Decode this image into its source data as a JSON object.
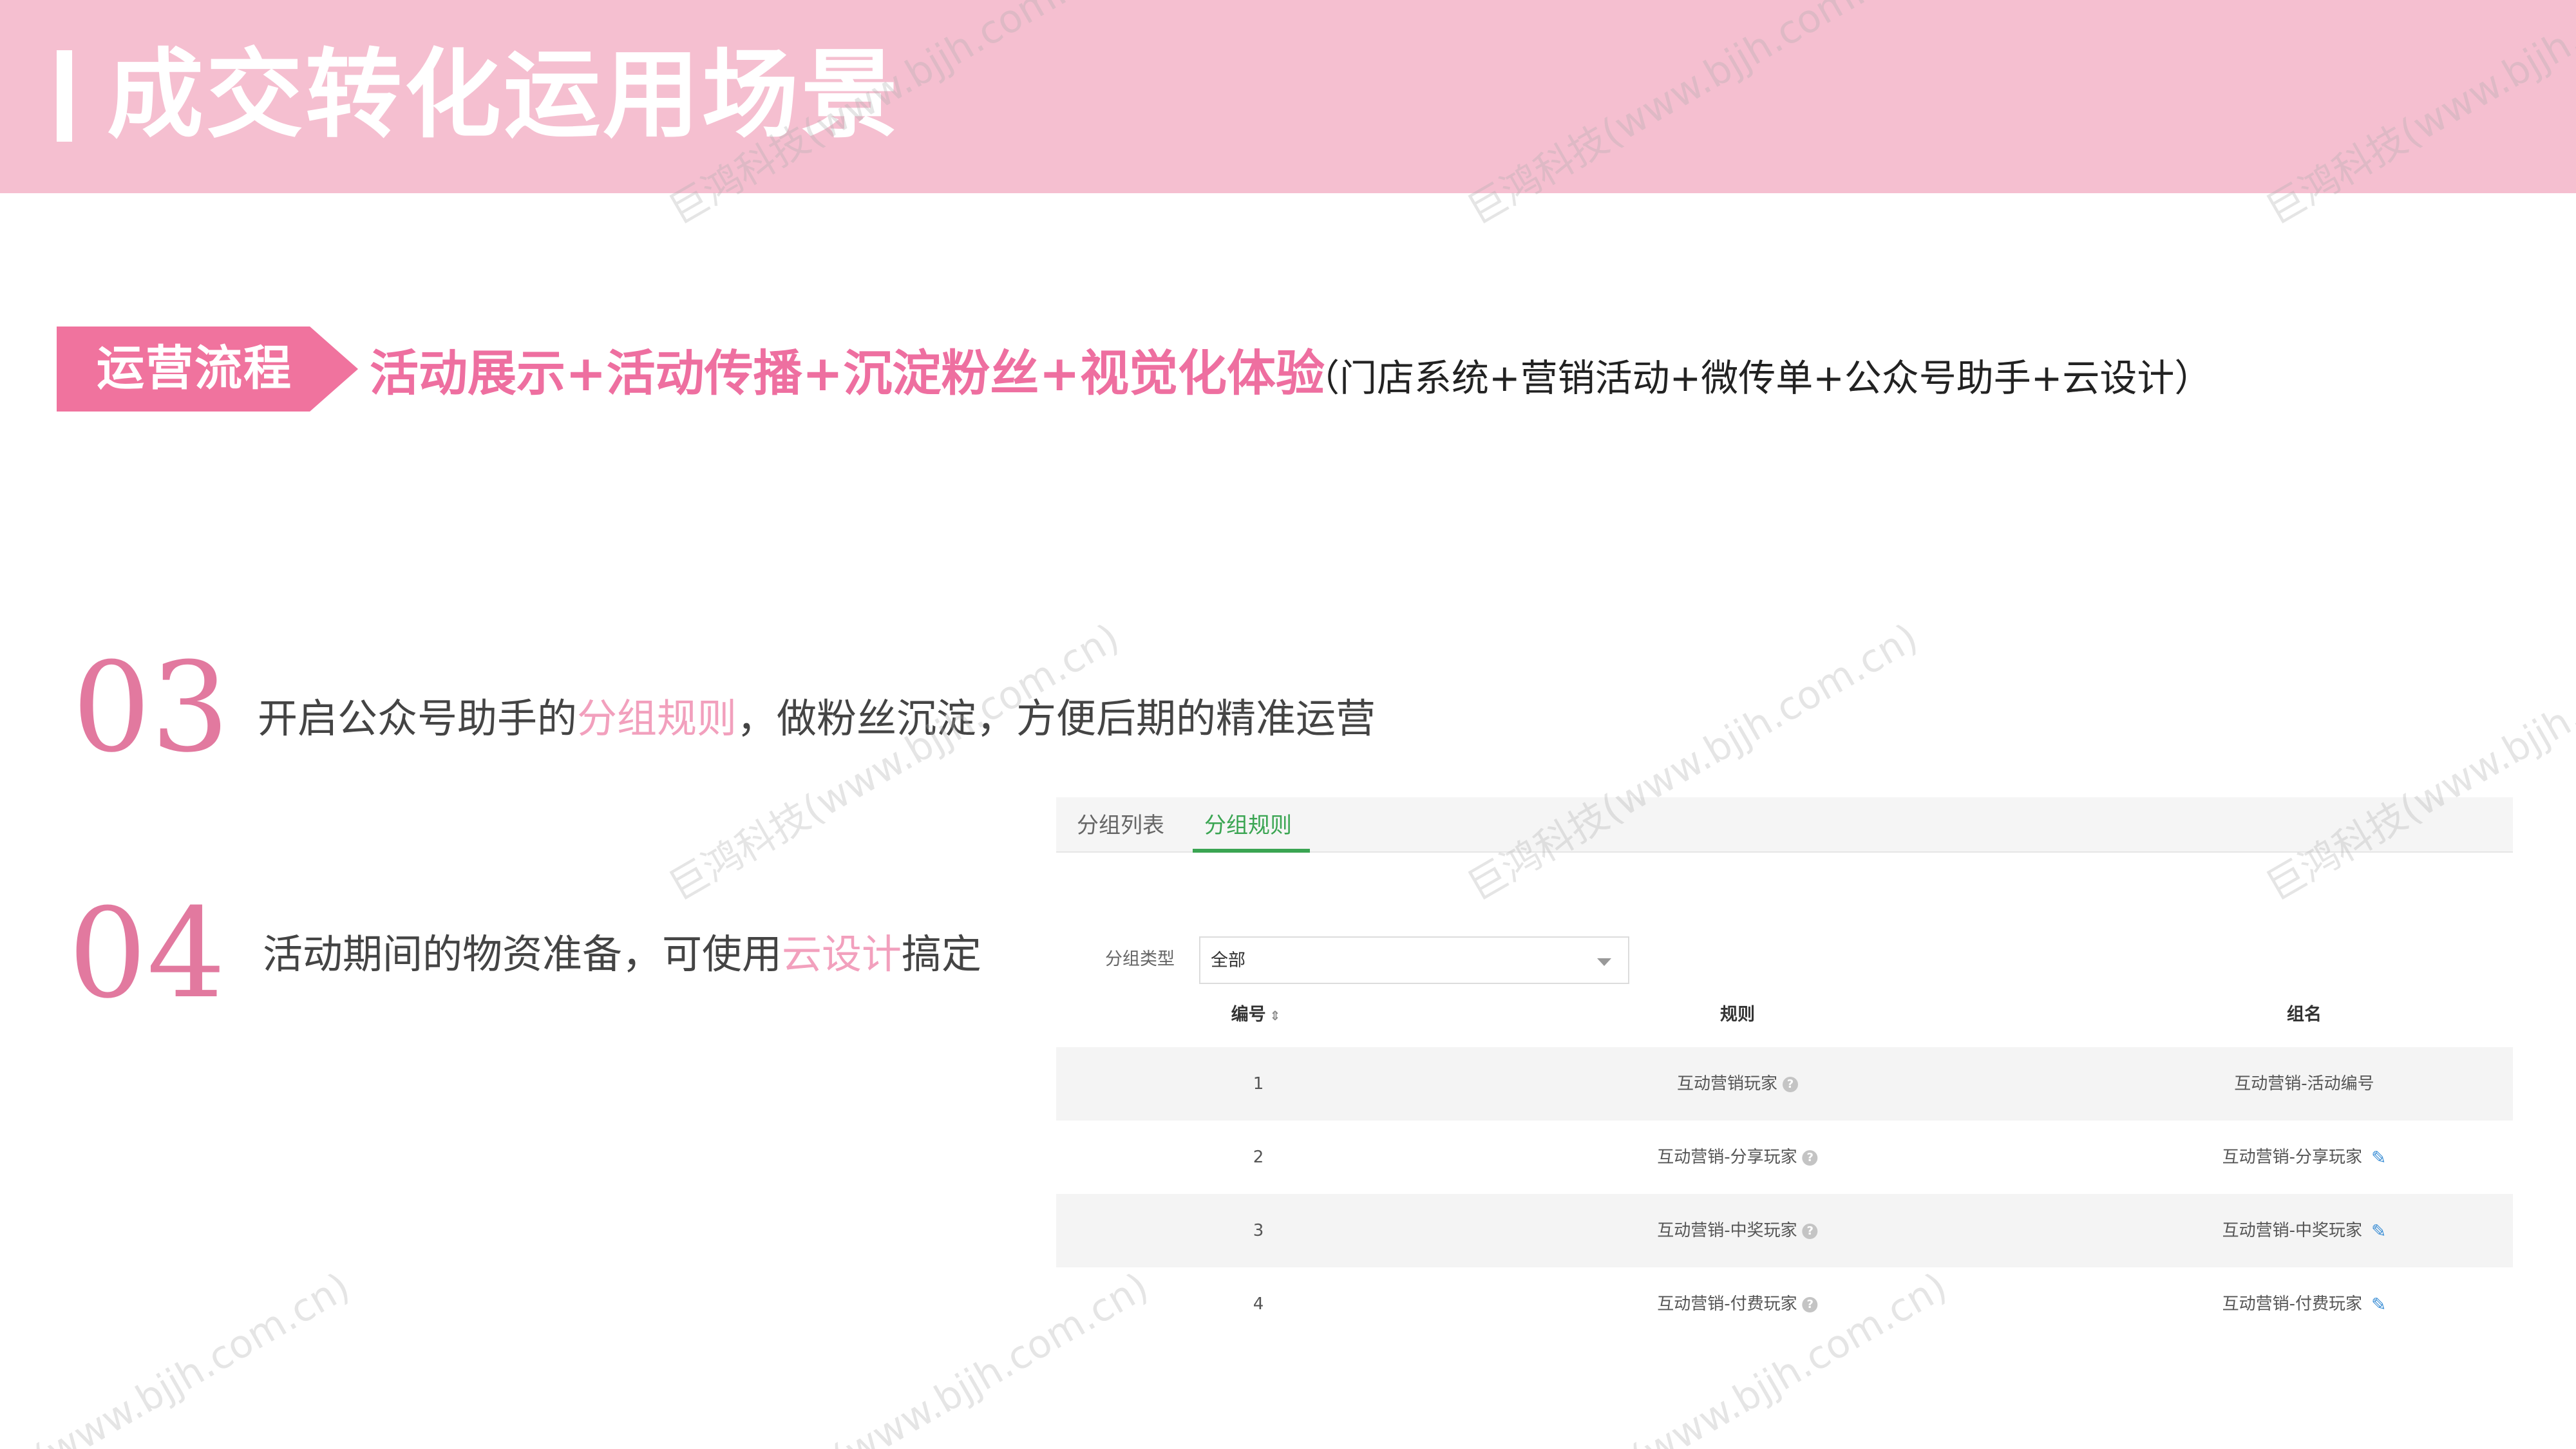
{
  "header": {
    "title": "成交转化运用场景"
  },
  "flow": {
    "tag": "运营流程",
    "main": "活动展示+活动传播+沉淀粉丝+视觉化体验",
    "sub": "（门店系统+营销活动+微传单+公众号助手+云设计）"
  },
  "steps": [
    {
      "number": "03",
      "text_before": "开启公众号助手的",
      "highlight": "分组规则",
      "text_after": "，做粉丝沉淀，方便后期的精准运营"
    },
    {
      "number": "04",
      "text_before": "活动期间的物资准备，可使用",
      "highlight": "云设计",
      "text_after": "搞定"
    }
  ],
  "panel": {
    "tabs": [
      "分组列表",
      "分组规则"
    ],
    "active_tab": "分组规则",
    "filter": {
      "label": "分组类型",
      "value": "全部"
    },
    "table": {
      "headers": [
        "编号",
        "规则",
        "组名"
      ],
      "sort_icon": "sort-icon",
      "rows": [
        {
          "id": "1",
          "rule": "互动营销玩家",
          "name": "互动营销-活动编号",
          "editable": false
        },
        {
          "id": "2",
          "rule": "互动营销-分享玩家",
          "name": "互动营销-分享玩家",
          "editable": true
        },
        {
          "id": "3",
          "rule": "互动营销-中奖玩家",
          "name": "互动营销-中奖玩家",
          "editable": true
        },
        {
          "id": "4",
          "rule": "互动营销-付费玩家",
          "name": "互动营销-付费玩家",
          "editable": true
        }
      ]
    }
  },
  "watermark": {
    "company": "巨鸿科技(www.bjjh.com.cn)",
    "site": "(www.bjjh.com.cn)"
  },
  "colors": {
    "header_bg": "#f5bfd0",
    "accent": "#f0739e",
    "highlight": "#f2a0bd",
    "step_number": "#e2799f",
    "active_tab": "#3aa552",
    "edit_icon": "#3c8fd6"
  }
}
